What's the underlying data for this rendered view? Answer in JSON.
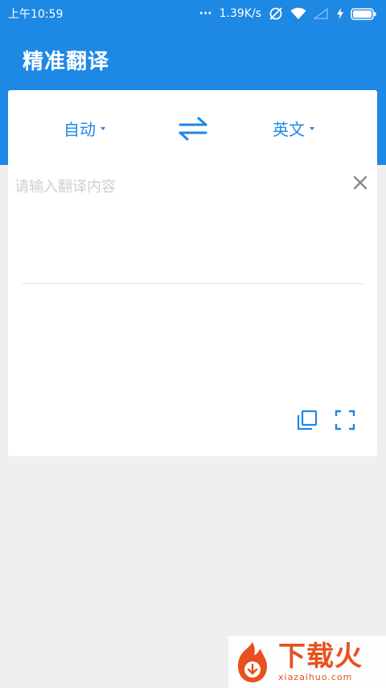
{
  "status_bar": {
    "time": "上午10:59",
    "dots": "···",
    "speed": "1.39K/s"
  },
  "app": {
    "title": "精准翻译"
  },
  "translator": {
    "source_lang": "自动",
    "target_lang": "英文",
    "input_placeholder": "请输入翻译内容",
    "input_value": ""
  },
  "icons": {
    "swap": "swap-arrows-icon",
    "clear": "close-icon",
    "copy": "copy-icon",
    "fullscreen": "fullscreen-icon"
  },
  "colors": {
    "primary": "#1e88e5",
    "background": "#efefef",
    "card": "#ffffff",
    "placeholder": "#cfcfcf",
    "watermark": "#e8501e"
  },
  "watermark": {
    "name": "下载火",
    "url": "xiazaihuo.com"
  }
}
